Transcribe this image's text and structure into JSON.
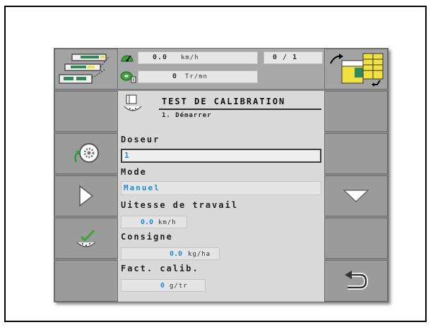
{
  "header": {
    "speed_value": "0.0",
    "speed_unit": "km/h",
    "page_counter": "0 / 1",
    "rotation_value": "0",
    "rotation_unit": "Tr/mn",
    "title": "TEST DE CALIBRATION",
    "subtitle": "1. Démarrer"
  },
  "form": {
    "doseur_label": "Doseur",
    "doseur_value": "1",
    "mode_label": "Mode",
    "mode_value": "Manuel",
    "vitesse_label": "Uitesse de travail",
    "vitesse_value": "0.0",
    "vitesse_unit": "km/h",
    "consigne_label": "Consigne",
    "consigne_value": "0.0",
    "consigne_unit": "kg/ha",
    "fact_label": "Fact. calib.",
    "fact_value": "0",
    "fact_unit": "g/tr"
  },
  "icons": {
    "left_top": "implement-layout-icon",
    "speed": "speedometer-icon",
    "rotation": "rotation-sensor-icon",
    "right_top": "hopper-sections-icon",
    "reset": "wheel-reset-icon",
    "play": "play-triangle-icon",
    "validate": "calibration-check-icon",
    "down": "arrow-down-icon",
    "back": "return-arrow-icon",
    "title_icon": "calibration-test-icon"
  },
  "colors": {
    "accent_blue": "#1d8ed6",
    "panel_gray": "#9b9b9b",
    "page_bg": "#d9d9d9"
  }
}
